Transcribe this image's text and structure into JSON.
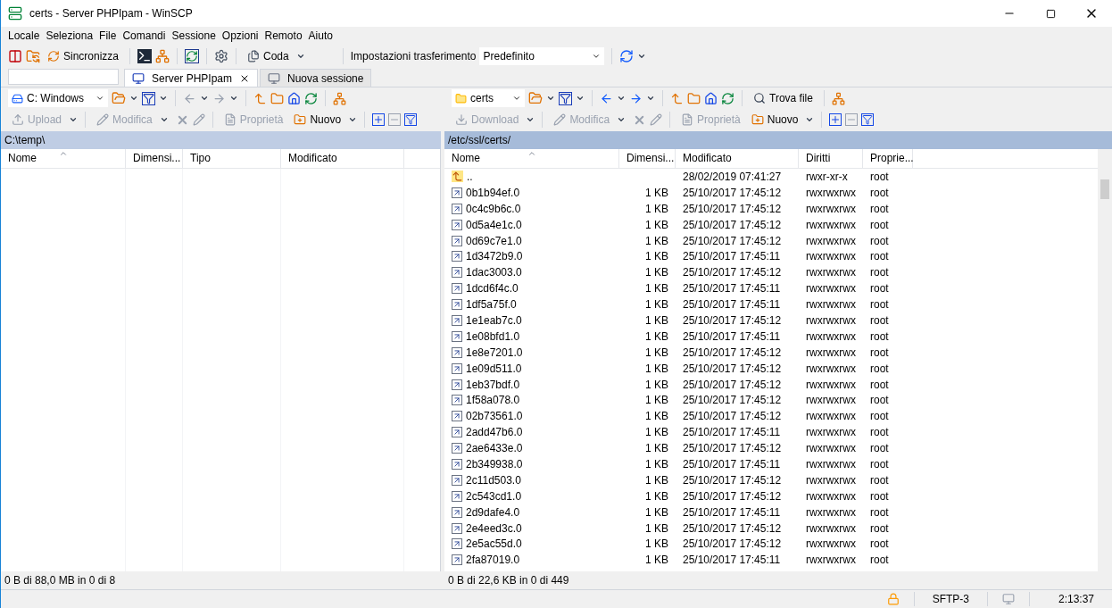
{
  "window": {
    "title": "certs - Server PHPIpam - WinSCP"
  },
  "menu": [
    "Locale",
    "Seleziona",
    "File",
    "Comandi",
    "Sessione",
    "Opzioni",
    "Remoto",
    "Aiuto"
  ],
  "toolbar": {
    "sync_label": "Sincronizza",
    "queue_label": "Coda",
    "transfer_label": "Impostazioni trasferimento",
    "transfer_value": "Predefinito"
  },
  "session_tabs": [
    {
      "label": "Server PHPIpam",
      "selected": true,
      "kind": "session"
    },
    {
      "label": "Nuova sessione",
      "selected": false,
      "kind": "new"
    }
  ],
  "left_pane": {
    "location": "C: Windows",
    "path": "C:\\temp\\",
    "actions": [
      {
        "label": "Upload",
        "disabled": true
      },
      {
        "label": "Modifica",
        "disabled": true
      },
      {
        "label": "Proprietà",
        "disabled": true
      },
      {
        "label": "Nuovo",
        "disabled": false
      }
    ],
    "columns": [
      {
        "label": "Nome",
        "sorted": true
      },
      {
        "label": "Dimensi...",
        "sorted": false
      },
      {
        "label": "Tipo",
        "sorted": false
      },
      {
        "label": "Modificato",
        "sorted": false
      }
    ],
    "status": "0 B di 88,0 MB in 0 di 8"
  },
  "right_pane": {
    "location": "certs",
    "find_label": "Trova file",
    "path": "/etc/ssl/certs/",
    "actions": [
      {
        "label": "Download",
        "disabled": true
      },
      {
        "label": "Modifica",
        "disabled": true
      },
      {
        "label": "Proprietà",
        "disabled": true
      },
      {
        "label": "Nuovo",
        "disabled": false
      }
    ],
    "columns": [
      {
        "label": "Nome",
        "sorted": true
      },
      {
        "label": "Dimensi...",
        "sorted": false
      },
      {
        "label": "Modificato",
        "sorted": false
      },
      {
        "label": "Diritti",
        "sorted": false
      },
      {
        "label": "Proprie...",
        "sorted": false
      }
    ],
    "rows": [
      {
        "kind": "parent",
        "name": "..",
        "size": "",
        "modified": "28/02/2019 07:41:27",
        "rights": "rwxr-xr-x",
        "owner": "root"
      },
      {
        "kind": "file",
        "name": "0b1b94ef.0",
        "size": "1 KB",
        "modified": "25/10/2017 17:45:12",
        "rights": "rwxrwxrwx",
        "owner": "root"
      },
      {
        "kind": "file",
        "name": "0c4c9b6c.0",
        "size": "1 KB",
        "modified": "25/10/2017 17:45:12",
        "rights": "rwxrwxrwx",
        "owner": "root"
      },
      {
        "kind": "file",
        "name": "0d5a4e1c.0",
        "size": "1 KB",
        "modified": "25/10/2017 17:45:12",
        "rights": "rwxrwxrwx",
        "owner": "root"
      },
      {
        "kind": "file",
        "name": "0d69c7e1.0",
        "size": "1 KB",
        "modified": "25/10/2017 17:45:12",
        "rights": "rwxrwxrwx",
        "owner": "root"
      },
      {
        "kind": "file",
        "name": "1d3472b9.0",
        "size": "1 KB",
        "modified": "25/10/2017 17:45:11",
        "rights": "rwxrwxrwx",
        "owner": "root"
      },
      {
        "kind": "file",
        "name": "1dac3003.0",
        "size": "1 KB",
        "modified": "25/10/2017 17:45:12",
        "rights": "rwxrwxrwx",
        "owner": "root"
      },
      {
        "kind": "file",
        "name": "1dcd6f4c.0",
        "size": "1 KB",
        "modified": "25/10/2017 17:45:11",
        "rights": "rwxrwxrwx",
        "owner": "root"
      },
      {
        "kind": "file",
        "name": "1df5a75f.0",
        "size": "1 KB",
        "modified": "25/10/2017 17:45:11",
        "rights": "rwxrwxrwx",
        "owner": "root"
      },
      {
        "kind": "file",
        "name": "1e1eab7c.0",
        "size": "1 KB",
        "modified": "25/10/2017 17:45:12",
        "rights": "rwxrwxrwx",
        "owner": "root"
      },
      {
        "kind": "file",
        "name": "1e08bfd1.0",
        "size": "1 KB",
        "modified": "25/10/2017 17:45:11",
        "rights": "rwxrwxrwx",
        "owner": "root"
      },
      {
        "kind": "file",
        "name": "1e8e7201.0",
        "size": "1 KB",
        "modified": "25/10/2017 17:45:12",
        "rights": "rwxrwxrwx",
        "owner": "root"
      },
      {
        "kind": "file",
        "name": "1e09d511.0",
        "size": "1 KB",
        "modified": "25/10/2017 17:45:12",
        "rights": "rwxrwxrwx",
        "owner": "root"
      },
      {
        "kind": "file",
        "name": "1eb37bdf.0",
        "size": "1 KB",
        "modified": "25/10/2017 17:45:12",
        "rights": "rwxrwxrwx",
        "owner": "root"
      },
      {
        "kind": "file",
        "name": "1f58a078.0",
        "size": "1 KB",
        "modified": "25/10/2017 17:45:12",
        "rights": "rwxrwxrwx",
        "owner": "root"
      },
      {
        "kind": "file",
        "name": "02b73561.0",
        "size": "1 KB",
        "modified": "25/10/2017 17:45:12",
        "rights": "rwxrwxrwx",
        "owner": "root"
      },
      {
        "kind": "file",
        "name": "2add47b6.0",
        "size": "1 KB",
        "modified": "25/10/2017 17:45:11",
        "rights": "rwxrwxrwx",
        "owner": "root"
      },
      {
        "kind": "file",
        "name": "2ae6433e.0",
        "size": "1 KB",
        "modified": "25/10/2017 17:45:12",
        "rights": "rwxrwxrwx",
        "owner": "root"
      },
      {
        "kind": "file",
        "name": "2b349938.0",
        "size": "1 KB",
        "modified": "25/10/2017 17:45:11",
        "rights": "rwxrwxrwx",
        "owner": "root"
      },
      {
        "kind": "file",
        "name": "2c11d503.0",
        "size": "1 KB",
        "modified": "25/10/2017 17:45:12",
        "rights": "rwxrwxrwx",
        "owner": "root"
      },
      {
        "kind": "file",
        "name": "2c543cd1.0",
        "size": "1 KB",
        "modified": "25/10/2017 17:45:12",
        "rights": "rwxrwxrwx",
        "owner": "root"
      },
      {
        "kind": "file",
        "name": "2d9dafe4.0",
        "size": "1 KB",
        "modified": "25/10/2017 17:45:11",
        "rights": "rwxrwxrwx",
        "owner": "root"
      },
      {
        "kind": "file",
        "name": "2e4eed3c.0",
        "size": "1 KB",
        "modified": "25/10/2017 17:45:12",
        "rights": "rwxrwxrwx",
        "owner": "root"
      },
      {
        "kind": "file",
        "name": "2e5ac55d.0",
        "size": "1 KB",
        "modified": "25/10/2017 17:45:12",
        "rights": "rwxrwxrwx",
        "owner": "root"
      },
      {
        "kind": "file",
        "name": "2fa87019.0",
        "size": "1 KB",
        "modified": "25/10/2017 17:45:11",
        "rights": "rwxrwxrwx",
        "owner": "root"
      }
    ],
    "status": "0 B di 22,6 KB in 0 di 449"
  },
  "status_bar": {
    "protocol": "SFTP-3",
    "elapsed": "2:13:37"
  }
}
